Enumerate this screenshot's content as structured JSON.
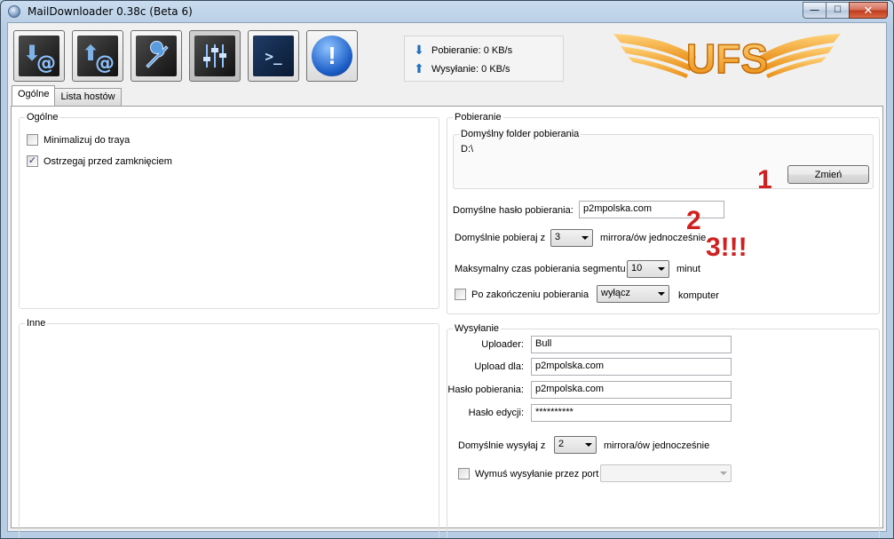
{
  "window": {
    "title": "MailDownloader 0.38c (Beta 6)",
    "caption": {
      "minimize": "—",
      "maximize": "☐",
      "close": "✕"
    }
  },
  "toolbar": {
    "buttons": [
      {
        "name": "download-mail",
        "icon": "download-at-icon",
        "glyph": "⬇",
        "at": "@"
      },
      {
        "name": "upload-mail",
        "icon": "upload-at-icon",
        "glyph": "⬆",
        "at": "@"
      },
      {
        "name": "tools",
        "icon": "wrench-icon",
        "glyph": "🔧"
      },
      {
        "name": "settings",
        "icon": "sliders-icon",
        "glyph": "⫶"
      },
      {
        "name": "console",
        "icon": "terminal-icon",
        "glyph": ">_"
      },
      {
        "name": "about",
        "icon": "info-exclamation-icon",
        "glyph": "!"
      }
    ]
  },
  "speed": {
    "download": "Pobieranie: 0 KB/s",
    "upload": "Wysyłanie: 0 KB/s"
  },
  "logo": {
    "text": "UFS",
    "colors": {
      "primary": "#f5a623",
      "shadow": "#c46d07"
    }
  },
  "tabs": [
    {
      "label": "Ogólne",
      "active": true
    },
    {
      "label": "Lista hostów",
      "active": false
    }
  ],
  "general": {
    "title": "Ogólne",
    "minimize_tray": {
      "label": "Minimalizuj do traya",
      "checked": false
    },
    "warn_close": {
      "label": "Ostrzegaj przed zamknięciem",
      "checked": true
    }
  },
  "other": {
    "title": "Inne"
  },
  "download": {
    "title": "Pobieranie",
    "folder_group_title": "Domyślny folder pobierania",
    "folder_path": "D:\\",
    "change_button": "Zmień",
    "password_label": "Domyślne hasło pobierania:",
    "password_value": "p2mpolska.com",
    "mirrors_label": "Domyślnie pobieraj z",
    "mirrors_value": "3",
    "mirrors_suffix": "mirrora/ów jednocześnie",
    "segment_label": "Maksymalny czas pobierania segmentu",
    "segment_value": "10",
    "segment_suffix": "minut",
    "after_label": "Po zakończeniu pobierania",
    "after_checked": false,
    "after_value": "wyłącz",
    "after_suffix": "komputer"
  },
  "upload": {
    "title": "Wysyłanie",
    "uploader_label": "Uploader:",
    "uploader_value": "Bull",
    "for_label": "Upload dla:",
    "for_value": "p2mpolska.com",
    "password_label": "Hasło pobierania:",
    "password_value": "p2mpolska.com",
    "edit_label": "Hasło edycji:",
    "edit_value": "**********",
    "mirrors_label": "Domyślnie wysyłaj z",
    "mirrors_value": "2",
    "mirrors_suffix": "mirrora/ów jednocześnie",
    "port_label": "Wymuś wysyłanie przez port",
    "port_checked": false,
    "port_value": ""
  },
  "annotations": {
    "a1": "1",
    "a2": "2",
    "a3": "3!!!"
  }
}
